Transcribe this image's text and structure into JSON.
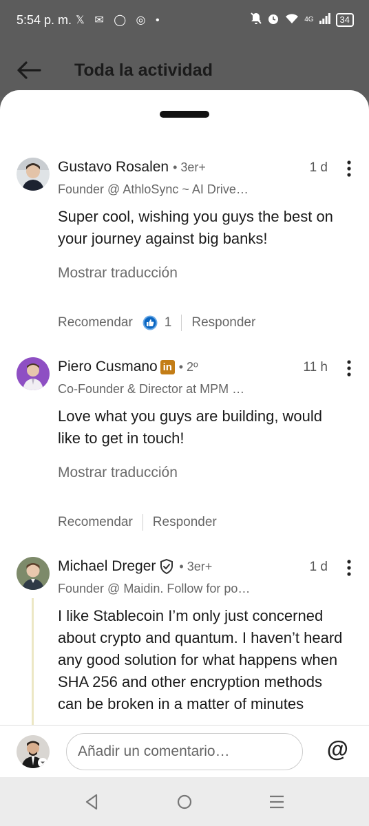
{
  "status_bar": {
    "time": "5:54 p. m.",
    "left_icons": "𝕏 ✉ ◯ ◎ •",
    "network": "4G",
    "battery": "34"
  },
  "header": {
    "title": "Toda la actividad"
  },
  "comments": [
    {
      "author": "Gustavo Rosalen",
      "degree": "• 3er+",
      "time": "1 d",
      "headline": "Founder @ AthloSync ~ AI Drive…",
      "text": "Super cool, wishing you guys the best on your journey against big banks!",
      "translate": "Mostrar traducción",
      "recommend": "Recomendar",
      "likes": "1",
      "reply": "Responder"
    },
    {
      "author": "Piero Cusmano",
      "badge": "in",
      "degree": "• 2º",
      "time": "11 h",
      "headline": "Co-Founder & Director at MPM …",
      "text": "Love what you guys are building, would like to get in touch!",
      "translate": "Mostrar traducción",
      "recommend": "Recomendar",
      "reply": "Responder"
    },
    {
      "author": "Michael Dreger",
      "degree": "• 3er+",
      "time": "1 d",
      "headline": "Founder @ Maidin. Follow for po…",
      "text": "I like Stablecoin I’m only just concerned about crypto and quantum. I haven’t heard any good solution for what happens when SHA 256 and other encryption methods can be broken in a matter of minutes"
    }
  ],
  "composer": {
    "placeholder": "Añadir un comentario…",
    "mention": "@"
  },
  "colors": {
    "premium_badge": "#c37d16",
    "like_blue": "#0a66c2",
    "thread_line": "#ece7c4"
  }
}
